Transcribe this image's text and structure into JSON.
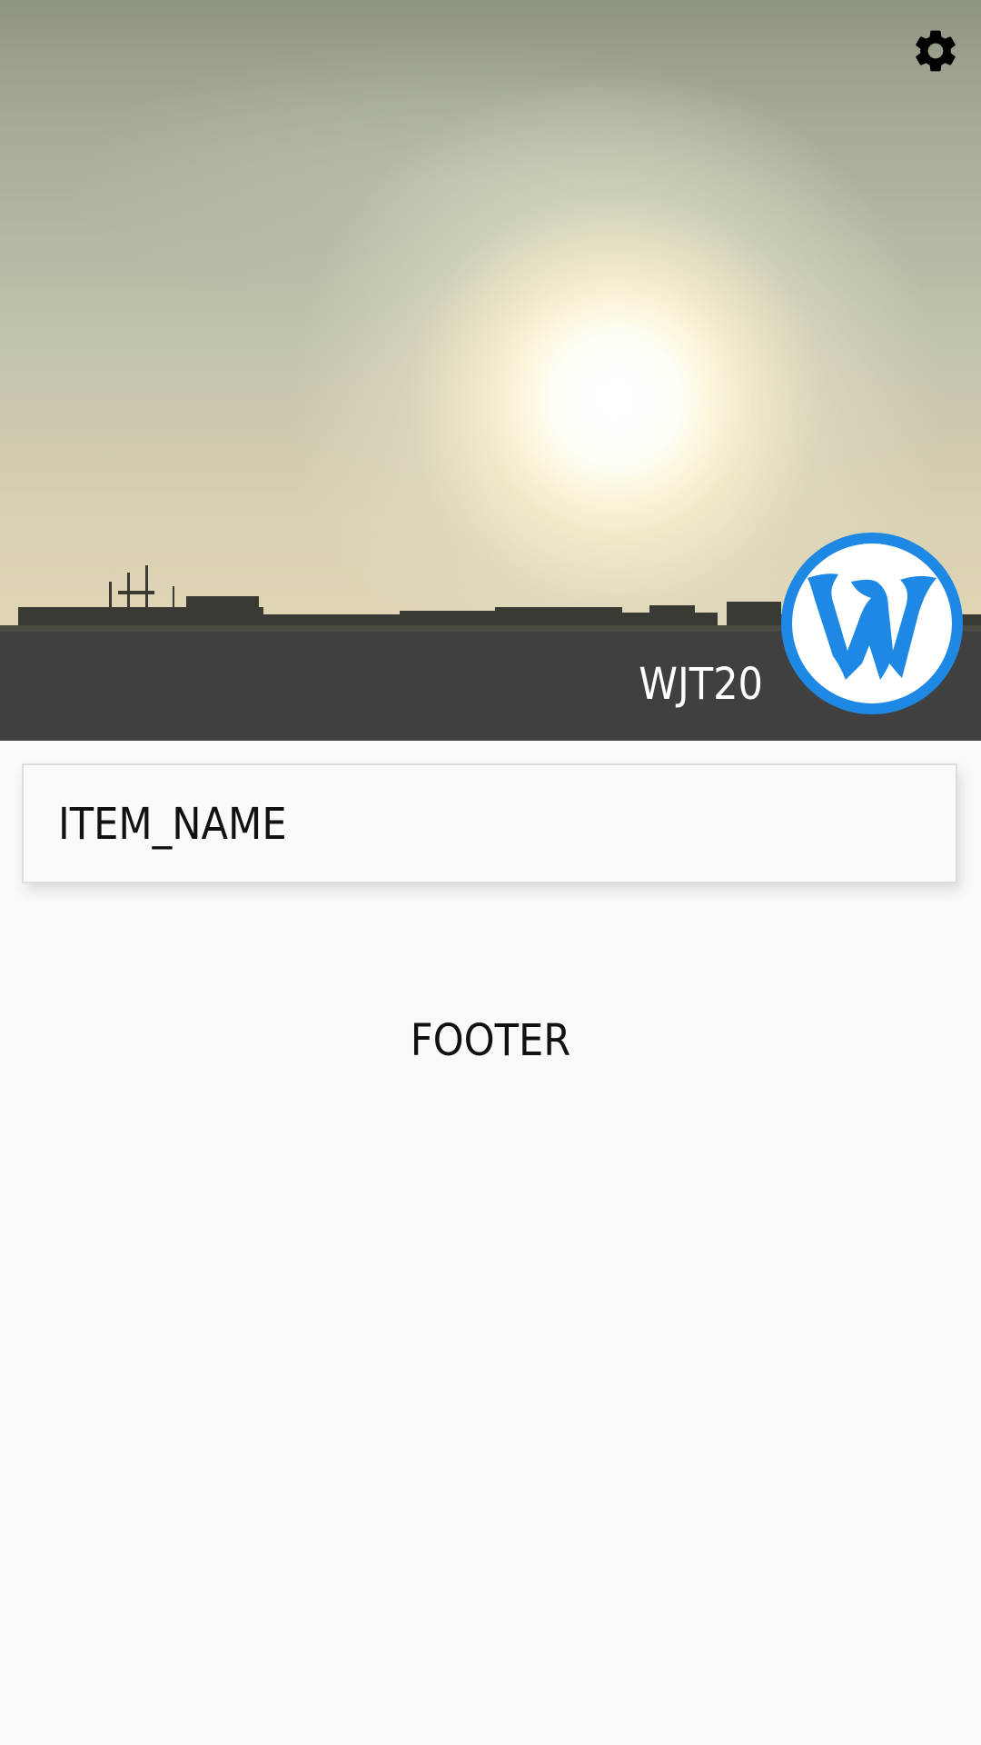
{
  "header": {
    "profile_name": "WJT20",
    "avatar_icon": "w-logo-icon",
    "settings_icon": "gear-icon",
    "background_image": "sky-sunset-photo",
    "band_color": "#404040",
    "avatar_color": "#1e88e5"
  },
  "list": {
    "items": [
      {
        "label": "ITEM_NAME"
      }
    ]
  },
  "footer": {
    "label": "FOOTER"
  }
}
